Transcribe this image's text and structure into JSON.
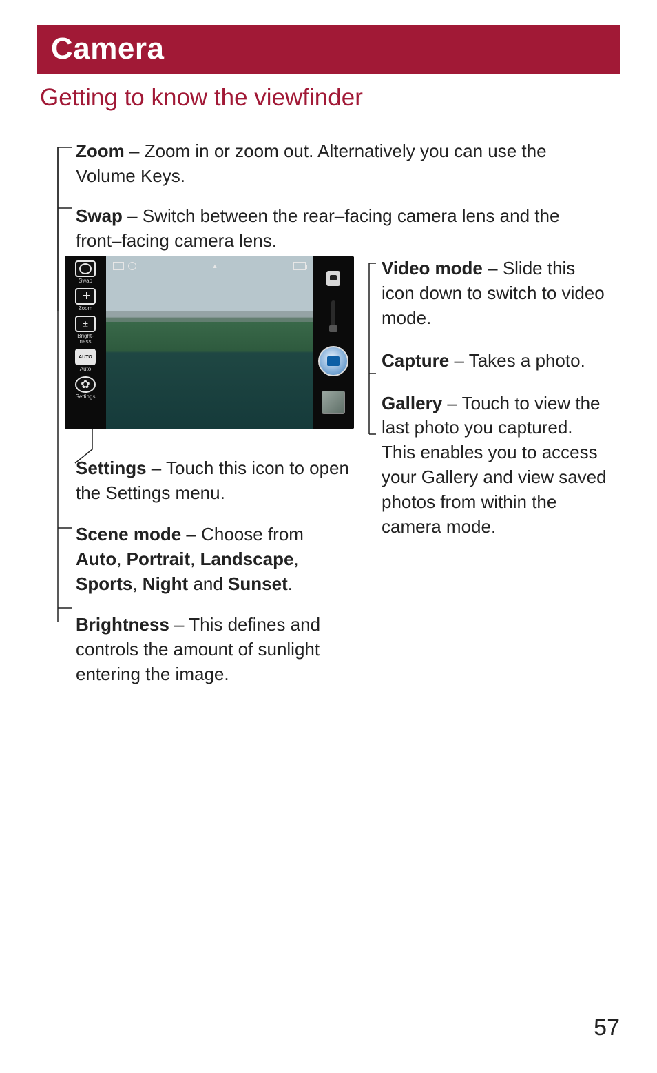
{
  "title": "Camera",
  "subtitle": "Getting to know the viewfinder",
  "page_number": "57",
  "callouts": {
    "zoom": {
      "label": "Zoom",
      "sep": " – ",
      "text": "Zoom in or zoom out. Alternatively you can use the Volume Keys."
    },
    "swap": {
      "label": "Swap",
      "sep": " – ",
      "text": "Switch between the rear–facing camera lens and the front–facing camera lens."
    },
    "video_mode": {
      "label": "Video mode",
      "sep": " – ",
      "text": "Slide this icon down to switch to video mode."
    },
    "capture": {
      "label": "Capture",
      "sep": " – ",
      "text": "Takes a photo."
    },
    "gallery": {
      "label": "Gallery",
      "sep": " – ",
      "text": "Touch to view the last photo you captured. This enables you to access your Gallery and view saved photos from within the camera mode."
    },
    "settings": {
      "label": "Settings",
      "sep": " – ",
      "text": "Touch this icon to open the Settings menu."
    },
    "scene_mode": {
      "label": "Scene mode",
      "sep": " – ",
      "lead": "Choose from ",
      "opts": [
        "Auto",
        "Portrait",
        "Landscape",
        "Sports",
        "Night",
        "Sunset"
      ],
      "comma": ", ",
      "and": " and ",
      "period": "."
    },
    "brightness": {
      "label": "Brightness",
      "sep": " – ",
      "text": "This defines and controls the amount of sunlight entering the image."
    }
  },
  "icons": {
    "swap_label": "Swap",
    "zoom_label": "Zoom",
    "brightness_label": "Bright-\nness",
    "auto_label": "Auto",
    "settings_label": "Settings"
  }
}
